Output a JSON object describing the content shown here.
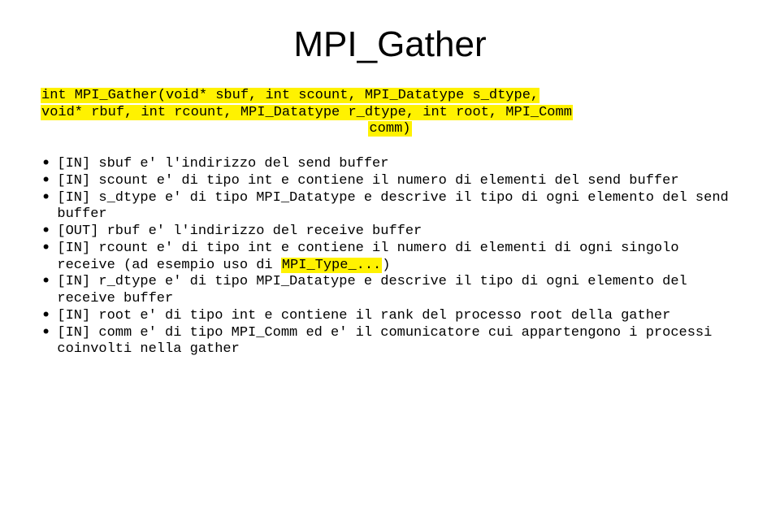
{
  "title": "MPI_Gather",
  "signature": {
    "line1_prefix": "int MPI_Gather(void* sbuf, int scount, MPI_Datatype s_dtype,",
    "line2": "void* rbuf, int rcount, MPI_Datatype r_dtype, int root, MPI_Comm",
    "line3": "comm)"
  },
  "params": [
    {
      "text": "[IN] sbuf e' l'indirizzo del send buffer",
      "highlights": []
    },
    {
      "text": "[IN] scount e' di tipo int e contiene il numero di elementi del send buffer",
      "highlights": []
    },
    {
      "text": "[IN] s_dtype e' di tipo MPI_Datatype e descrive il tipo di ogni elemento del send buffer",
      "highlights": []
    },
    {
      "text": "[OUT] rbuf e' l'indirizzo del receive buffer",
      "highlights": []
    },
    {
      "pre": "[IN] rcount e' di tipo int e contiene il numero di elementi di ogni singolo receive (ad esempio uso di ",
      "hl": "MPI_Type_...",
      "post": ")",
      "highlights": [
        "MPI_Type_..."
      ]
    },
    {
      "text": "[IN] r_dtype e' di tipo MPI_Datatype e descrive il tipo di ogni elemento del receive buffer",
      "highlights": []
    },
    {
      "text": "[IN] root e' di tipo int e contiene il rank del processo root della gather",
      "highlights": []
    },
    {
      "text": "[IN] comm e' di tipo MPI_Comm ed e' il comunicatore cui appartengono i processi coinvolti nella gather",
      "highlights": []
    }
  ]
}
